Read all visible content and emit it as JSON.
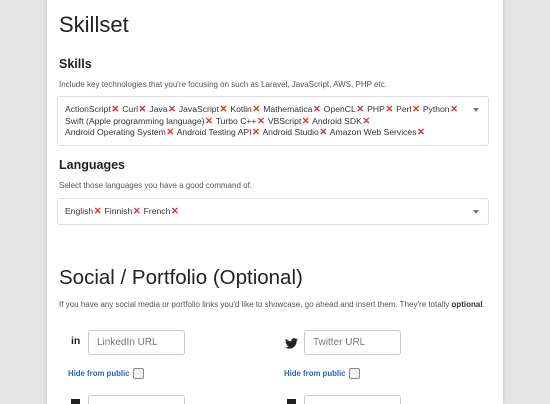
{
  "skillset": {
    "title": "Skillset",
    "skills_label": "Skills",
    "skills_help": "Include key technologies that you're focusing on such as Laravel, JavaScript, AWS, PHP etc.",
    "skills": [
      "ActionScript",
      "Curl",
      "Java",
      "JavaScript",
      "Kotlin",
      "Mathematica",
      "OpenCL",
      "PHP",
      "Perl",
      "Python",
      "Swift (Apple programming language)",
      "Turbo C++",
      "VBScript",
      "Android SDK",
      "Android Operating System",
      "Android Testing API",
      "Android Studio",
      "Amazon Web Services"
    ],
    "languages_label": "Languages",
    "languages_help": "Select those languages you have a good command of.",
    "languages": [
      "English",
      "Finnish",
      "French"
    ],
    "remove_glyph": "✕"
  },
  "social": {
    "title": "Social / Portfolio (Optional)",
    "help_text": "If you have any social media or portfolio links you'd like to showcase, go ahead and insert them. They're totally",
    "help_bold": "optional",
    "help_end": ".",
    "linkedin_icon_glyph": "in",
    "linkedin_placeholder": "LinkedIn URL",
    "twitter_placeholder": "Twitter URL",
    "hide_label": "Hide from public",
    "icon_color": "#222222",
    "link_color": "#2a63c4",
    "remove_color": "#e0352b"
  }
}
